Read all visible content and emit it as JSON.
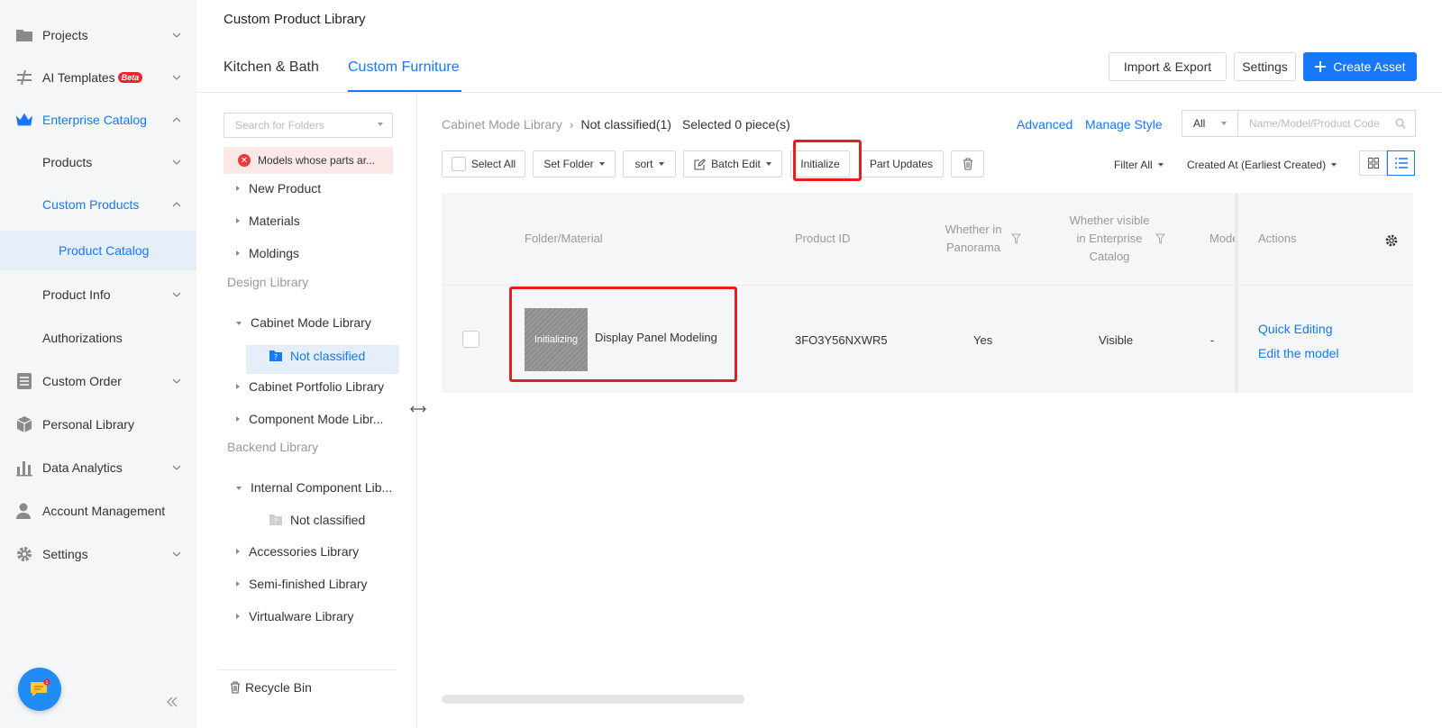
{
  "sidebar": {
    "items": [
      {
        "label": "Projects",
        "icon": "folder-icon"
      },
      {
        "label": "AI Templates",
        "badge": "Beta",
        "icon": "ai-templates-icon"
      },
      {
        "label": "Enterprise Catalog",
        "icon": "crown-icon"
      },
      {
        "label": "Products"
      },
      {
        "label": "Custom Products"
      },
      {
        "label": "Product Catalog"
      },
      {
        "label": "Product Info"
      },
      {
        "label": "Authorizations"
      },
      {
        "label": "Custom Order",
        "icon": "list-icon"
      },
      {
        "label": "Personal Library",
        "icon": "cube-icon"
      },
      {
        "label": "Data Analytics",
        "icon": "bar-chart-icon"
      },
      {
        "label": "Account Management",
        "icon": "user-icon"
      },
      {
        "label": "Settings",
        "icon": "gear-icon"
      }
    ],
    "chat_badge": "1"
  },
  "header": {
    "title": "Custom Product Library",
    "tabs": [
      {
        "label": "Kitchen & Bath"
      },
      {
        "label": "Custom Furniture"
      }
    ],
    "buttons": {
      "import_export": "Import & Export",
      "settings": "Settings",
      "create_asset": "Create Asset"
    }
  },
  "tree": {
    "search_placeholder": "Search for Folders",
    "error_item": "Models whose parts ar...",
    "groups1": [
      "New Product",
      "Materials",
      "Moldings"
    ],
    "section_design": "Design Library",
    "cabinet_mode": "Cabinet Mode Library",
    "not_classified_selected": "Not classified",
    "cabinet_portfolio": "Cabinet Portfolio Library",
    "component_mode": "Component Mode Libr...",
    "section_backend": "Backend Library",
    "internal_component": "Internal Component Lib...",
    "not_classified_2": "Not classified",
    "accessories": "Accessories Library",
    "semi_finished": "Semi-finished Library",
    "virtualware": "Virtualware Library",
    "recycle_bin": "Recycle Bin"
  },
  "content": {
    "breadcrumb": {
      "root": "Cabinet Mode Library",
      "current": "Not classified(1)",
      "selected": "Selected 0 piece(s)"
    },
    "advanced": "Advanced",
    "manage_style": "Manage Style",
    "filter_scope": "All",
    "search_placeholder": "Name/Model/Product Code",
    "toolbar": {
      "select_all": "Select All",
      "set_folder": "Set Folder",
      "sort": "sort",
      "batch_edit": "Batch Edit",
      "initialize": "Initialize",
      "part_updates": "Part Updates",
      "filter_all": "Filter All",
      "created_at": "Created At (Earliest Created)"
    },
    "table": {
      "headers": {
        "folder_material": "Folder/Material",
        "product_id": "Product ID",
        "in_panorama_1": "Whether in",
        "in_panorama_2": "Panorama",
        "visible_1": "Whether visible",
        "visible_2": "in Enterprise",
        "visible_3": "Catalog",
        "model": "Mode",
        "actions": "Actions"
      },
      "rows": [
        {
          "thumb_label": "Initializing",
          "name": "Display Panel Modeling",
          "product_id": "3FO3Y56NXWR5",
          "in_panorama": "Yes",
          "visible": "Visible",
          "model": "-",
          "action_quick": "Quick Editing",
          "action_edit": "Edit the model"
        }
      ]
    }
  },
  "colors": {
    "accent": "#1677ff",
    "highlight": "#e41f1f",
    "error": "#e83a3a"
  }
}
